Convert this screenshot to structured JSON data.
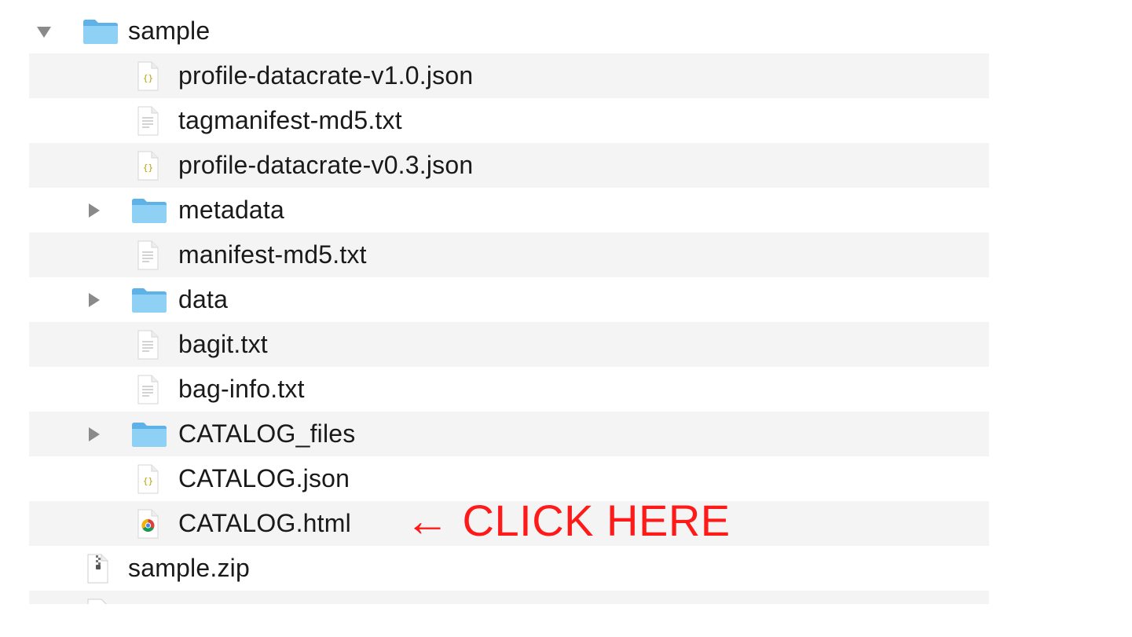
{
  "finder": {
    "root": {
      "name": "sample",
      "expanded": true
    },
    "children": [
      {
        "name": "profile-datacrate-v1.0.json",
        "icon": "json-file-icon"
      },
      {
        "name": "tagmanifest-md5.txt",
        "icon": "text-file-icon"
      },
      {
        "name": "profile-datacrate-v0.3.json",
        "icon": "json-file-icon"
      },
      {
        "name": "metadata",
        "icon": "folder-icon",
        "expanded": false
      },
      {
        "name": "manifest-md5.txt",
        "icon": "text-file-icon"
      },
      {
        "name": "data",
        "icon": "folder-icon",
        "expanded": false
      },
      {
        "name": "bagit.txt",
        "icon": "text-file-icon"
      },
      {
        "name": "bag-info.txt",
        "icon": "text-file-icon"
      },
      {
        "name": "CATALOG_files",
        "icon": "folder-icon",
        "expanded": false
      },
      {
        "name": "CATALOG.json",
        "icon": "json-file-icon"
      },
      {
        "name": "CATALOG.html",
        "icon": "chrome-html-icon"
      }
    ],
    "siblings": [
      {
        "name": "sample.zip",
        "icon": "zip-file-icon"
      }
    ]
  },
  "annotation": {
    "text": "← CLICK HERE",
    "color": "#ff1a1a"
  },
  "colors": {
    "row_alt": "#f4f4f4",
    "folder": "#7cc7f2",
    "annotation": "#ff1a1a"
  }
}
